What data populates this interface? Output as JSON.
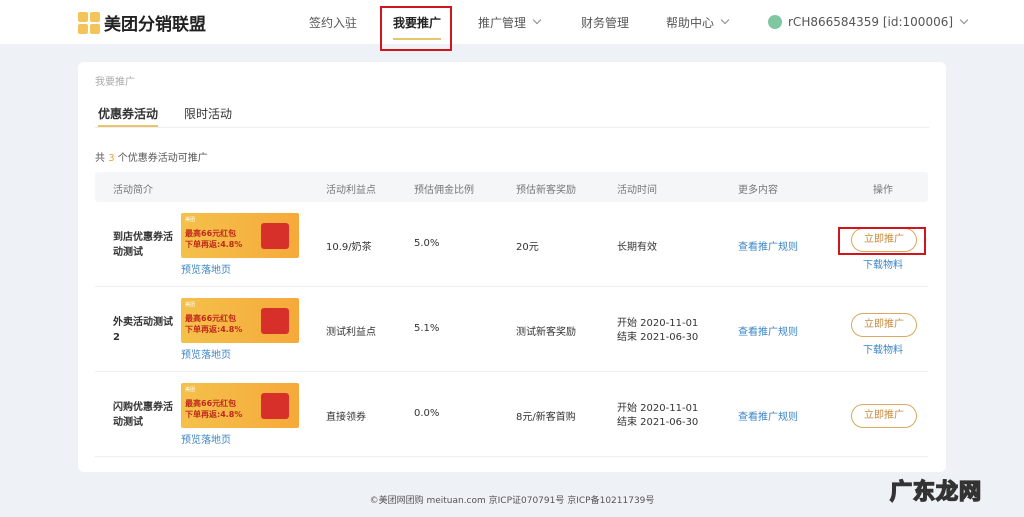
{
  "header": {
    "logo": "美团分销联盟",
    "nav": [
      {
        "label": "签约入驻"
      },
      {
        "label": "我要推广"
      },
      {
        "label": "推广管理"
      },
      {
        "label": "财务管理"
      },
      {
        "label": "帮助中心"
      }
    ],
    "user": "rCH866584359 [id:100006]"
  },
  "breadcrumb": "我要推广",
  "tabs": [
    {
      "label": "优惠券活动"
    },
    {
      "label": "限时活动"
    }
  ],
  "count": {
    "prefix": "共",
    "num": "3",
    "suffix": "个优惠券活动可推广"
  },
  "columns": [
    "活动简介",
    "活动利益点",
    "预估佣金比例",
    "预估新客奖励",
    "活动时间",
    "更多内容",
    "操作"
  ],
  "banner": {
    "brand": "美团",
    "line1": "最高66元红包",
    "line2": "下单再返:4.8%"
  },
  "rows": [
    {
      "name": "到店优惠券活动测试",
      "preview": "预览落地页",
      "benefit": "10.9/奶茶",
      "ratio": "5.0%",
      "reward": "20元",
      "time1": "长期有效",
      "time2": "",
      "more": "查看推广规则",
      "promote": "立即推广",
      "download": "下载物料"
    },
    {
      "name": "外卖活动测试2",
      "preview": "预览落地页",
      "benefit": "测试利益点",
      "ratio": "5.1%",
      "reward": "测试新客奖励",
      "time1": "开始 2020-11-01",
      "time2": "结束 2021-06-30",
      "more": "查看推广规则",
      "promote": "立即推广",
      "download": "下载物料"
    },
    {
      "name": "闪购优惠券活动测试",
      "preview": "预览落地页",
      "benefit": "直接领券",
      "ratio": "0.0%",
      "reward": "8元/新客首购",
      "time1": "开始 2020-11-01",
      "time2": "结束 2021-06-30",
      "more": "查看推广规则",
      "promote": "立即推广",
      "download": ""
    }
  ],
  "footer": "©美团网团购 meituan.com 京ICP证070791号 京ICP备10211739号",
  "watermark": "广东龙网"
}
